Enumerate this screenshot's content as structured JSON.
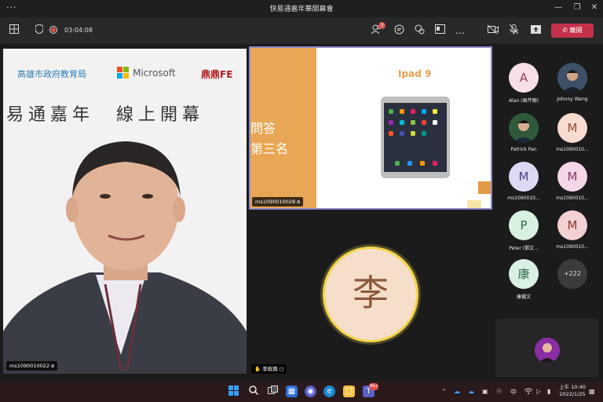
{
  "window": {
    "dots": "···",
    "title": "快易通嘉年華開幕會"
  },
  "toolbar": {
    "timer": "03:04:08",
    "notification_count": "3",
    "leave_label": "離開"
  },
  "main_video": {
    "logo_left": "高雄市政府教育局",
    "logo_center": "Microsoft",
    "logo_right": "鼎鼎FE",
    "banner_title": "易通嘉年　線上開幕",
    "label": "ms1090010022"
  },
  "shared_content": {
    "left_text_line1": "問答",
    "left_text_line2": "第三名",
    "heading": "Ipad 9",
    "label": "ms1090010028"
  },
  "active_speaker": {
    "initial": "李",
    "label": "李政興"
  },
  "roster": [
    {
      "initial": "A",
      "name": "Alan (高芹剛)",
      "bg": "#f6dfe6",
      "fg": "#9a3b5c"
    },
    {
      "initial": "",
      "name": "Johnny Wang",
      "photo": true
    },
    {
      "initial": "",
      "name": "Patrick Pan",
      "photo": true
    },
    {
      "initial": "M",
      "name": "ms1090010...",
      "bg": "#f7dccf",
      "fg": "#9a4a3a"
    },
    {
      "initial": "M",
      "name": "ms1090010...",
      "bg": "#dcd9f3",
      "fg": "#4b4790"
    },
    {
      "initial": "M",
      "name": "ms1090010...",
      "bg": "#f3d6e7",
      "fg": "#8a3a6a"
    },
    {
      "initial": "P",
      "name": "Peter (鄧文...",
      "bg": "#d8f0e0",
      "fg": "#2f6e46"
    },
    {
      "initial": "M",
      "name": "ms1090010...",
      "bg": "#f3d1d2",
      "fg": "#8a3436"
    },
    {
      "initial": "康",
      "name": "康儷文",
      "bg": "#daf0e4",
      "fg": "#2f6e4e"
    }
  ],
  "roster_more": "+222",
  "taskbar": {
    "teams_badge": "99+",
    "ime": "中",
    "time": "上午 10:40",
    "date": "2022/1/25"
  }
}
